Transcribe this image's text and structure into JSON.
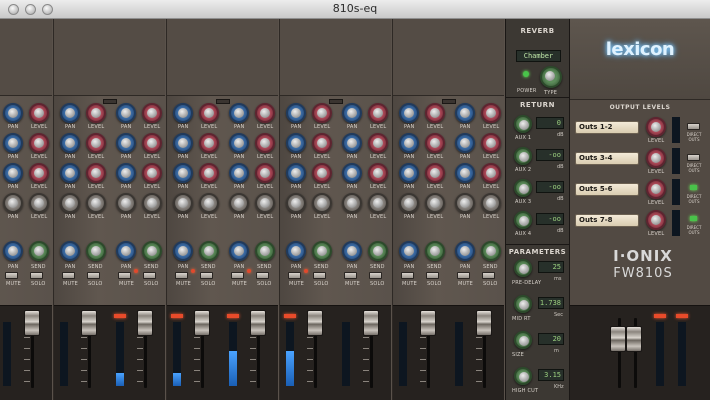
{
  "window": {
    "title": "810s-eq"
  },
  "reverb": {
    "title": "REVERB",
    "type_value": "Chamber",
    "power_label": "POWER",
    "type_label": "TYPE"
  },
  "return": {
    "title": "RETURN",
    "channels": [
      {
        "label": "AUX 1",
        "value": "0",
        "unit": "dB"
      },
      {
        "label": "AUX 2",
        "value": "-oo",
        "unit": "dB"
      },
      {
        "label": "AUX 3",
        "value": "-oo",
        "unit": "dB"
      },
      {
        "label": "AUX 4",
        "value": "-oo",
        "unit": "dB"
      }
    ]
  },
  "parameters": {
    "title": "PARAMETERS",
    "items": [
      {
        "label": "PRE-DELAY",
        "value": "25",
        "unit": "ms"
      },
      {
        "label": "MID RT",
        "value": "1.738",
        "unit": "Sec"
      },
      {
        "label": "SIZE",
        "value": "20",
        "unit": "m"
      },
      {
        "label": "HIGH CUT",
        "value": "3.15",
        "unit": "KHz"
      }
    ]
  },
  "output": {
    "title": "OUTPUT LEVELS",
    "rows": [
      {
        "label": "Outs 1-2",
        "level_label": "LEVEL",
        "direct": "DIRECT OUTS",
        "direct_on": false
      },
      {
        "label": "Outs 3-4",
        "level_label": "LEVEL",
        "direct": "DIRECT OUTS",
        "direct_on": false
      },
      {
        "label": "Outs 5-6",
        "level_label": "LEVEL",
        "direct": "DIRECT OUTS",
        "direct_on": true
      },
      {
        "label": "Outs 7-8",
        "level_label": "LEVEL",
        "direct": "DIRECT OUTS",
        "direct_on": true
      }
    ]
  },
  "brand": {
    "logo": "lexicon",
    "product_line1": "I·ONIX",
    "product_line2": "FW810S"
  },
  "strip_labels": {
    "pan": "PAN",
    "level": "LEVEL",
    "send": "SEND",
    "mute": "MUTE",
    "solo": "SOLO"
  },
  "colors": {
    "accent_blue": "#3c6ea8",
    "accent_red": "#b04a5a",
    "lcd_green": "#9bd07f",
    "panel": "#5a524b"
  },
  "meters": {
    "levels": [
      0.0,
      0.0,
      0.0,
      0.2,
      0.2,
      0.55,
      0.55,
      0.0,
      0.0,
      0.0,
      0.0,
      0.0,
      0.0,
      0.0,
      0.0,
      0.0
    ],
    "peaks": [
      false,
      false,
      false,
      true,
      true,
      true,
      true,
      false,
      false,
      false,
      false,
      false,
      false,
      false,
      false,
      false
    ]
  }
}
